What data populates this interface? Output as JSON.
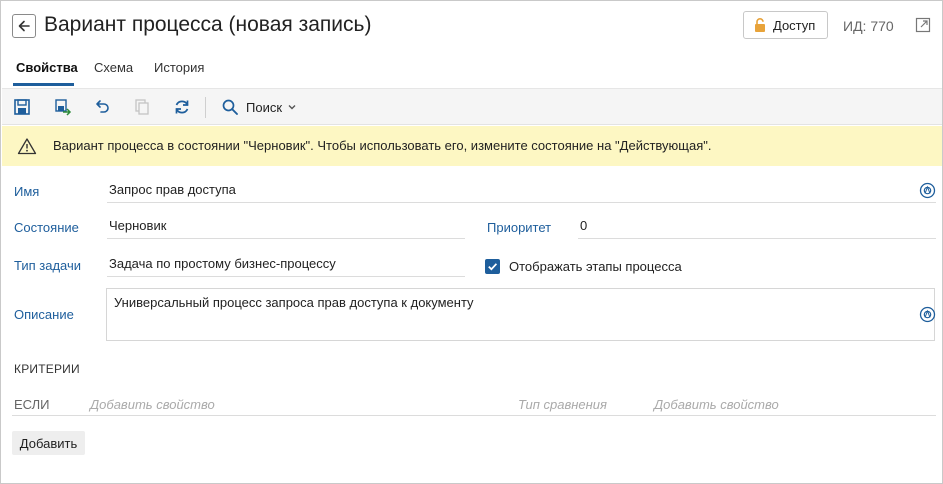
{
  "header": {
    "title": "Вариант процесса (новая запись)",
    "access_label": "Доступ",
    "id_label": "ИД: 770"
  },
  "tabs": [
    {
      "label": "Свойства",
      "active": true
    },
    {
      "label": "Схема",
      "active": false
    },
    {
      "label": "История",
      "active": false
    }
  ],
  "toolbar": {
    "search_label": "Поиск"
  },
  "warning": {
    "text": "Вариант процесса в состоянии \"Черновик\". Чтобы использовать его, измените состояние на \"Действующая\"."
  },
  "form": {
    "name_label": "Имя",
    "name_value": "Запрос прав доступа",
    "state_label": "Состояние",
    "state_value": "Черновик",
    "priority_label": "Приоритет",
    "priority_value": "0",
    "task_type_label": "Тип задачи",
    "task_type_value": "Задача по простому бизнес-процессу",
    "show_stages_label": "Отображать этапы процесса",
    "show_stages_checked": true,
    "description_label": "Описание",
    "description_value": "Универсальный процесс запроса прав доступа к документу"
  },
  "criteria": {
    "title": "КРИТЕРИИ",
    "if_label": "ЕСЛИ",
    "add_property_placeholder": "Добавить свойство",
    "comparison_placeholder": "Тип сравнения",
    "add_property_placeholder_2": "Добавить свойство",
    "add_button": "Добавить"
  },
  "colors": {
    "accent": "#1e5e9c",
    "warning_bg": "#fdf7c3",
    "access_icon": "#e8a33a"
  }
}
